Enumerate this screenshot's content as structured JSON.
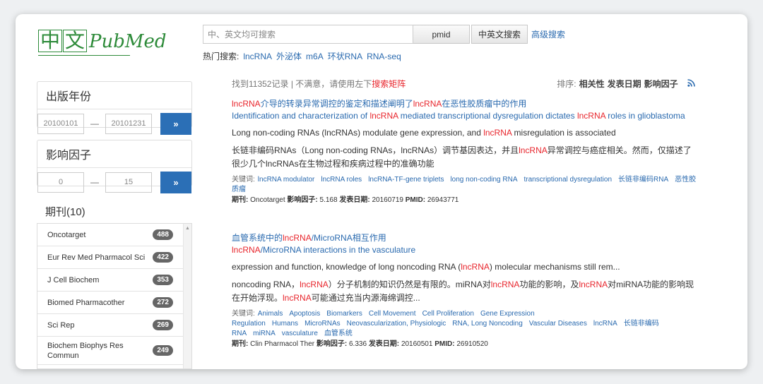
{
  "logo": {
    "cn1": "中",
    "cn2": "文",
    "en": "PubMed"
  },
  "search": {
    "placeholder": "中、英文均可搜索",
    "pmid_label": "pmid",
    "cn_en_label": "中英文搜索",
    "advanced_label": "高级搜索"
  },
  "hot": {
    "label": "热门搜索:",
    "keywords": [
      "lncRNA",
      "外泌体",
      "m6A",
      "环状RNA",
      "RNA-seq"
    ]
  },
  "filters": {
    "year": {
      "title": "出版年份",
      "from": "20100101",
      "dash": "—",
      "to": "20101231",
      "go": "»"
    },
    "impact": {
      "title": "影响因子",
      "from": "0",
      "dash": "—",
      "to": "15",
      "go": "»"
    },
    "journal_title": "期刊(10)",
    "journals": [
      {
        "name": "Oncotarget",
        "count": "488"
      },
      {
        "name": "Eur Rev Med Pharmacol Sci",
        "count": "422"
      },
      {
        "name": "J Cell Biochem",
        "count": "353"
      },
      {
        "name": "Biomed Pharmacother",
        "count": "272"
      },
      {
        "name": "Sci Rep",
        "count": "269"
      },
      {
        "name": "Biochem Biophys Res Commun",
        "count": "249"
      }
    ]
  },
  "results_header": {
    "found_prefix": "找到11352记录 | 不满意，请使用左下",
    "found_link": "搜索矩阵",
    "sort_label": "排序:",
    "sort_options": [
      "相关性",
      "发表日期",
      "影响因子"
    ],
    "rss_icon": "rss-icon"
  },
  "results": [
    {
      "cn_title": {
        "a": "lncRNA",
        "b": "介导的转录异常调控的鉴定和描述阐明了",
        "c": "lncRNA",
        "d": "在恶性胶质瘤中的作用"
      },
      "en_title": {
        "a": "Identification and characterization of ",
        "b": "lncRNA",
        "c": " mediated transcriptional dysregulation dictates ",
        "d": "lncRNA",
        "e": " roles in glioblastoma"
      },
      "abstract_en": {
        "a": "Long non-coding RNAs (lncRNAs) modulate gene expression, and ",
        "b": "lncRNA",
        "c": " misregulation is associated"
      },
      "abstract_cn": {
        "a": "长链非编码RNAs（Long non-coding RNAs，lncRNAs）调节基因表达，并且",
        "b": "lncRNA",
        "c": "异常调控与癌症相关。然而，仅描述了很少几个lncRNAs在生物过程和疾病过程中的准确功能"
      },
      "keywords_label": "关键词:",
      "keywords": [
        "lncRNA modulator",
        "lncRNA roles",
        "lncRNA-TF-gene triplets",
        "long non-coding RNA",
        "transcriptional dysregulation",
        "长链非编码RNA",
        "恶性胶质瘤"
      ],
      "journal_label": "期刊:",
      "journal": "Oncotarget",
      "if_label": "影响因子:",
      "if": "5.168",
      "date_label": "发表日期:",
      "date": "20160719",
      "pmid_label": "PMID:",
      "pmid": "26943771"
    },
    {
      "cn_title": {
        "a": "血管系统中的",
        "b": "lncRNA",
        "c": "/MicroRNA相互作用"
      },
      "en_title": {
        "a": "lncRNA",
        "b": "/MicroRNA interactions in the vasculature"
      },
      "abstract_en": {
        "a": "expression and function, knowledge of long noncoding RNA (",
        "b": "lncRNA",
        "c": ") molecular mechanisms still rem..."
      },
      "abstract_cn": {
        "a": "noncoding RNA，",
        "b": "lncRNA",
        "c": "）分子机制的知识仍然是有限的。miRNA对",
        "d": "lncRNA",
        "e": "功能的影响，及",
        "f": "lncRNA",
        "g": "对miRNA功能的影响现在开始浮现。",
        "h": "lncRNA",
        "i": "可能通过充当内源海绵调控..."
      },
      "keywords_label": "关键词:",
      "keywords": [
        "Animals",
        "Apoptosis",
        "Biomarkers",
        "Cell Movement",
        "Cell Proliferation",
        "Gene Expression Regulation",
        "Humans",
        "MicroRNAs",
        "Neovascularization, Physiologic",
        "RNA, Long Noncoding",
        "Vascular Diseases",
        "lncRNA",
        "长链非编码RNA",
        "miRNA",
        "vasculature",
        "血管系统"
      ],
      "journal_label": "期刊:",
      "journal": "Clin Pharmacol Ther",
      "if_label": "影响因子:",
      "if": "6.336",
      "date_label": "发表日期:",
      "date": "20160501",
      "pmid_label": "PMID:",
      "pmid": "26910520"
    }
  ]
}
